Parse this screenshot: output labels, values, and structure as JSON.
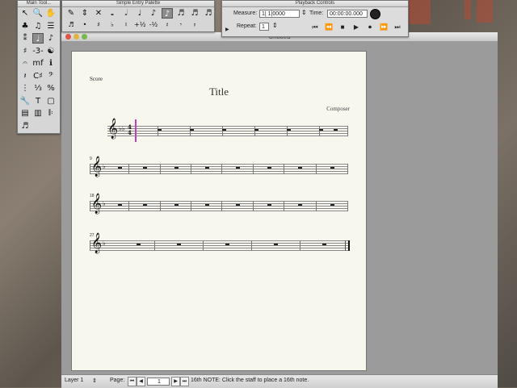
{
  "main_tools": {
    "title": "Main Tool...",
    "tools": [
      "↖",
      "🔍",
      "✋",
      "♣",
      "♫",
      "☰",
      "⁑",
      "♩",
      "♪",
      "♯",
      "-3-",
      "☯",
      "𝄐",
      "mf",
      "ℹ",
      "𝄽",
      "C♯",
      "𝄢",
      "⋮",
      "⅓",
      "%",
      "🔧",
      "T",
      "▢",
      "▤",
      "▥",
      "𝄆",
      "♬"
    ]
  },
  "simple_entry": {
    "title": "Simple Entry Palette",
    "row1": [
      "✎",
      "⇕",
      "✕",
      "𝅝",
      "𝅗𝅥",
      "♩",
      "♪",
      "♪",
      "♬",
      "♬",
      "♬"
    ],
    "row2": [
      "♬",
      "•",
      "♯",
      "♭",
      "♮",
      "+½",
      "-½",
      "𝄽",
      "𝄾",
      "𝄿"
    ]
  },
  "playback": {
    "title": "Playback Controls",
    "measure_label": "Measure:",
    "measure_value": "1| 1|0000",
    "time_label": "Time:",
    "time_value": "00:00:00.000",
    "repeat_label": "Repeat:",
    "repeat_value": "1",
    "buttons": [
      "⏮",
      "⏪",
      "■",
      "▶",
      "⏺",
      "⏩",
      "⏭"
    ]
  },
  "document": {
    "window_title": "Untitled",
    "score_label": "Score",
    "title": "Title",
    "composer": "Composer",
    "measure_numbers": [
      "9",
      "18",
      "27"
    ]
  },
  "statusbar": {
    "layer": "Layer 1",
    "page_label": "Page:",
    "page_value": "1",
    "message": "16th NOTE: Click the staff to place a 16th note."
  }
}
